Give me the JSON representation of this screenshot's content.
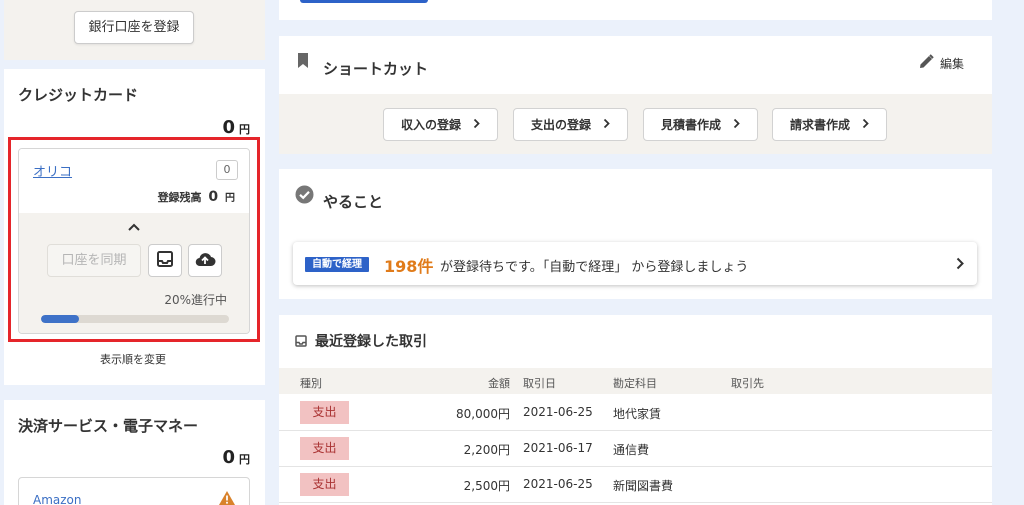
{
  "left": {
    "register_bank_button": "銀行口座を登録",
    "credit_card": {
      "title": "クレジットカード",
      "total_amount": "0",
      "currency": "円",
      "account": {
        "name": "オリコ",
        "count": "0",
        "balance_label": "登録残高",
        "balance_value": "0",
        "currency": "円",
        "collapse_icon": "chevron-up-icon",
        "sync_button": "口座を同期",
        "inbox_icon": "inbox-icon",
        "upload_icon": "cloud-upload-icon",
        "progress_text": "20%進行中",
        "progress_fraction": 0.2
      },
      "reorder_link": "表示順を変更"
    },
    "payment_services": {
      "title": "決済サービス・電子マネー",
      "total_amount": "0",
      "currency": "円",
      "account_name": "Amazon",
      "warning_icon": "warning-icon"
    }
  },
  "shortcuts": {
    "title": "ショートカット",
    "edit_label": "編集",
    "items": [
      {
        "label": "収入の登録"
      },
      {
        "label": "支出の登録"
      },
      {
        "label": "見積書作成"
      },
      {
        "label": "請求書作成"
      }
    ]
  },
  "todo": {
    "title": "やること",
    "tag": "自動で経理",
    "count": "198件",
    "message": "が登録待ちです。「自動で経理」 から登録しましょう"
  },
  "recent": {
    "title": "最近登録した取引",
    "columns": [
      "種別",
      "金額",
      "取引日",
      "勘定科目",
      "取引先"
    ],
    "rows": [
      {
        "type": "支出",
        "amount": "80,000円",
        "date": "2021-06-25",
        "account": "地代家賃",
        "partner": ""
      },
      {
        "type": "支出",
        "amount": "2,200円",
        "date": "2021-06-17",
        "account": "通信費",
        "partner": ""
      },
      {
        "type": "支出",
        "amount": "2,500円",
        "date": "2021-06-25",
        "account": "新聞図書費",
        "partner": ""
      }
    ]
  },
  "colors": {
    "accent_blue": "#3e72c8",
    "tag_blue": "#2d62c8",
    "count_orange": "#e07b1a",
    "expense_bg": "#f2c2c2",
    "highlight_red": "#e5252a",
    "warning_orange": "#d9822b"
  }
}
